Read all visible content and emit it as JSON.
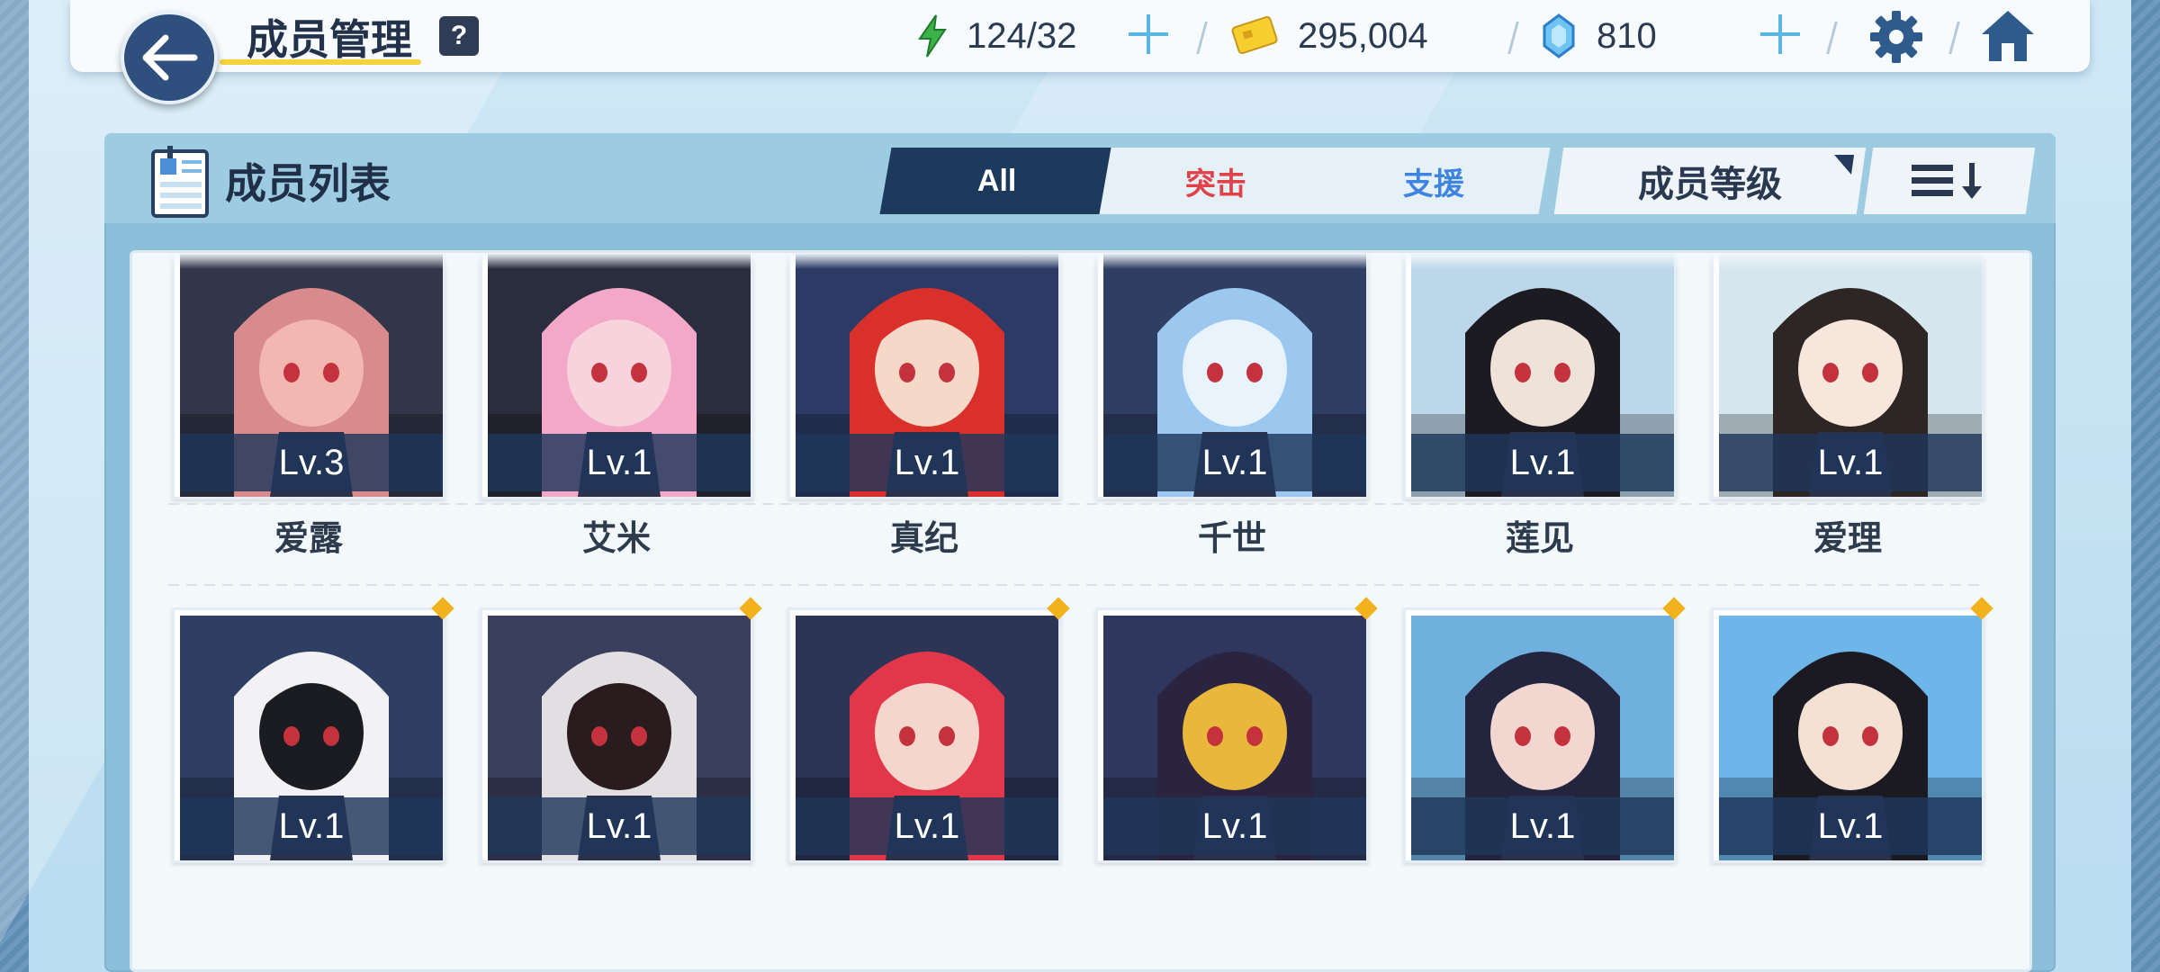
{
  "header": {
    "title": "成员管理",
    "help": "?",
    "stamina": "124/32",
    "credits": "295,004",
    "gems": "810"
  },
  "panel": {
    "title": "成员列表",
    "tabs": [
      "All",
      "突击",
      "支援"
    ],
    "sort_label": "成员等级"
  },
  "members": [
    {
      "level": "Lv.3",
      "name": "爱露",
      "colors": [
        "#d98a8c",
        "#f2b7b0",
        "#31364a"
      ]
    },
    {
      "level": "Lv.1",
      "name": "艾米",
      "colors": [
        "#f2a8c6",
        "#f7d3de",
        "#2a2d3d"
      ]
    },
    {
      "level": "Lv.1",
      "name": "真纪",
      "colors": [
        "#d9302c",
        "#f5d8c8",
        "#2b3b66"
      ]
    },
    {
      "level": "Lv.1",
      "name": "千世",
      "colors": [
        "#9cc8ef",
        "#e9f3fb",
        "#2f3f63"
      ]
    },
    {
      "level": "Lv.1",
      "name": "莲见",
      "colors": [
        "#1c1b22",
        "#efe2d8",
        "#bcd7ea"
      ]
    },
    {
      "level": "Lv.1",
      "name": "爱理",
      "colors": [
        "#2d2624",
        "#f6e6dc",
        "#d6e6ef"
      ]
    },
    {
      "level": "Lv.1",
      "name": "",
      "colors": [
        "#f2f2f4",
        "#1a1c22",
        "#2f3e63"
      ]
    },
    {
      "level": "Lv.1",
      "name": "",
      "colors": [
        "#e2dfe2",
        "#2a1c1e",
        "#3b3f5e"
      ]
    },
    {
      "level": "Lv.1",
      "name": "",
      "colors": [
        "#e2364a",
        "#f5d6cc",
        "#2c3556"
      ]
    },
    {
      "level": "Lv.1",
      "name": "",
      "colors": [
        "#2a2440",
        "#e9b73b",
        "#30375e"
      ]
    },
    {
      "level": "Lv.1",
      "name": "",
      "colors": [
        "#23243d",
        "#f2d6d0",
        "#6fb0df"
      ]
    },
    {
      "level": "Lv.1",
      "name": "",
      "colors": [
        "#1b1a22",
        "#f4e1d4",
        "#6db6ea"
      ]
    }
  ],
  "theme": {
    "accent": "#1d3a5c",
    "strike": "#e0424a",
    "support": "#3e84e0",
    "badge": "#f2b21e"
  }
}
